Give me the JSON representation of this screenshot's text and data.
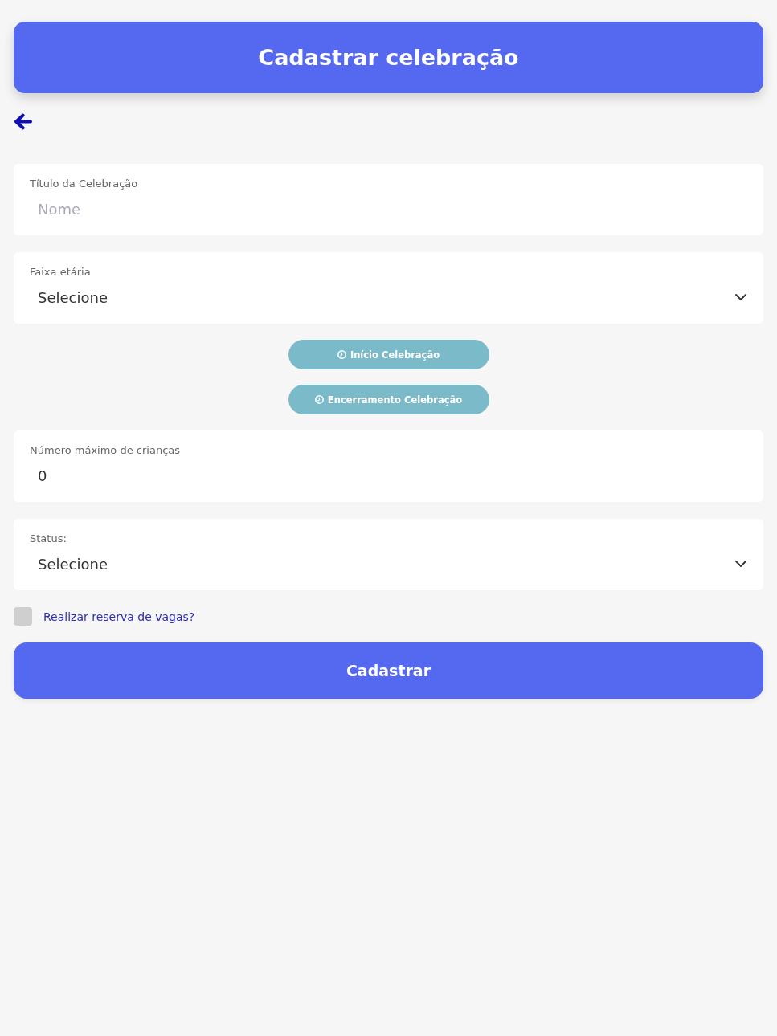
{
  "header": {
    "title": "Cadastrar celebração"
  },
  "form_items": [
    {
      "kind": "input",
      "label": "Título da Celebração",
      "placeholder": "Nome"
    },
    {
      "kind": "select",
      "label": "Faixa etária",
      "value": "Selecione"
    },
    {
      "kind": "time_button",
      "label": "Início Celebração"
    },
    {
      "kind": "time_button",
      "label": "Encerramento Celebração"
    },
    {
      "kind": "input",
      "label": "Número máximo de crianças",
      "value": "0"
    },
    {
      "kind": "select",
      "label": "Status:",
      "value": "Selecione"
    }
  ],
  "reservation": {
    "label": "Realizar reserva de vagas?",
    "checked": false
  },
  "submit": {
    "label": "Cadastrar"
  }
}
